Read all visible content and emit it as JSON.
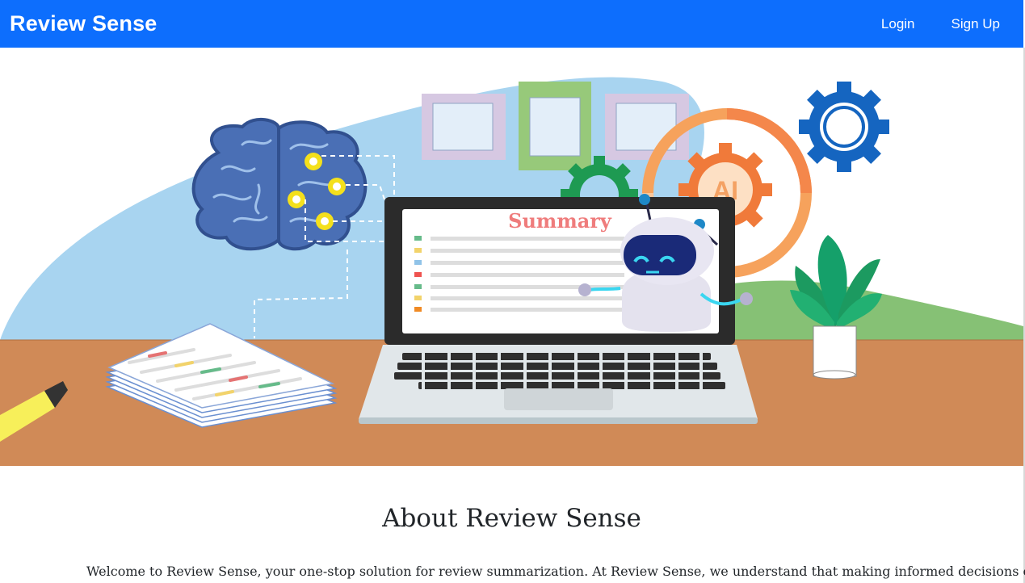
{
  "navbar": {
    "brand": "Review Sense",
    "links": [
      {
        "label": "Login"
      },
      {
        "label": "Sign Up"
      }
    ]
  },
  "hero": {
    "screen_heading": "Summary",
    "badge_text": "AI",
    "colors": {
      "sky": "#a8d4f0",
      "desk": "#d08a57",
      "hill": "#7dbf6e",
      "brain": "#4a6fb5",
      "gear_blue": "#1565c0",
      "gear_orange": "#f07a3a"
    }
  },
  "about": {
    "title": "About Review Sense",
    "text": "Welcome to Review Sense, your one-stop solution for review summarization. At Review Sense, we understand that making informed decisions can be"
  }
}
